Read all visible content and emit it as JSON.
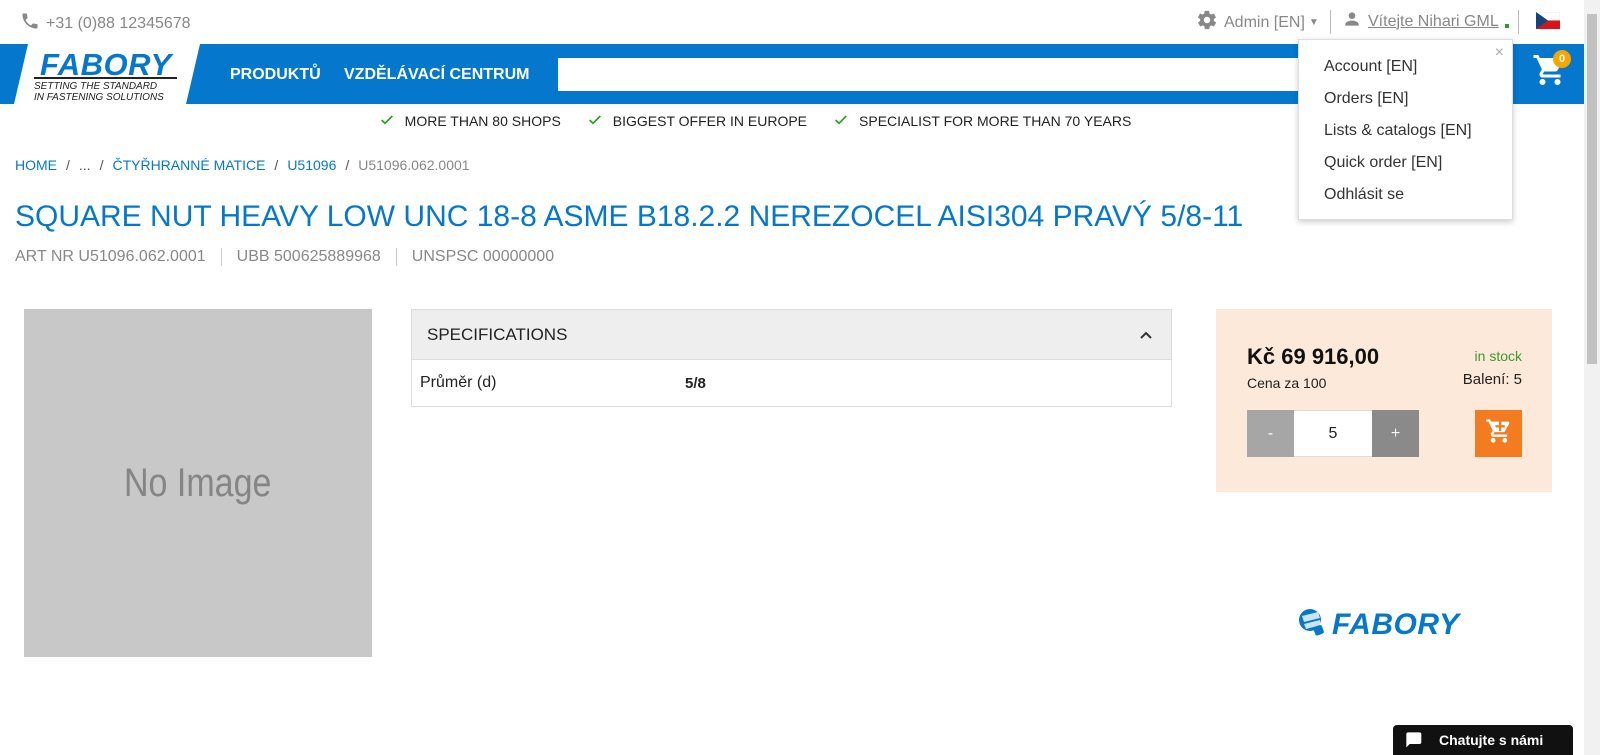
{
  "topbar": {
    "phone": "+31 (0)88 12345678",
    "admin_label": "Admin [EN]",
    "welcome_label": "Vítejte Nihari GML"
  },
  "header": {
    "logo_text": "FABORY",
    "logo_tagline_1": "SETTING THE STANDARD",
    "logo_tagline_2": "IN FASTENING SOLUTIONS",
    "nav": [
      "PRODUKTŮ",
      "VZDĚLÁVACÍ CENTRUM"
    ],
    "search_placeholder": "",
    "cart_count": "0"
  },
  "benefits": [
    "MORE THAN 80 SHOPS",
    "BIGGEST OFFER IN EUROPE",
    "SPECIALIST FOR MORE THAN 70 YEARS"
  ],
  "breadcrumb": {
    "items": [
      "HOME",
      "...",
      "ČTYŘHRANNÉ MATICE",
      "U51096"
    ],
    "current": "U51096.062.0001"
  },
  "product": {
    "title": "SQUARE NUT HEAVY LOW UNC 18-8 ASME B18.2.2 NEREZOCEL AISI304 PRAVÝ 5/8-11",
    "art_nr": "ART NR U51096.062.0001",
    "ubb": "UBB 500625889968",
    "unspsc": "UNSPSC 00000000",
    "image_placeholder": "No Image"
  },
  "specifications": {
    "heading": "SPECIFICATIONS",
    "rows": [
      {
        "key": "Průměr (d)",
        "value": "5/8"
      }
    ]
  },
  "pricing": {
    "price": "Kč 69 916,00",
    "per": "Cena za 100",
    "stock": "in stock",
    "pack": "Balení: 5",
    "minus": "-",
    "plus": "+",
    "quantity": "5"
  },
  "brand_logo": "FABORY",
  "account_menu": {
    "close": "×",
    "items": [
      "Account [EN]",
      "Orders [EN]",
      "Lists & catalogs [EN]",
      "Quick order [EN]",
      "Odhlásit se"
    ]
  },
  "chat": {
    "label": "Chatujte s námi"
  },
  "colors": {
    "brand_blue": "#0578ce",
    "cart_orange": "#f47c20",
    "stock_green": "#3a9a2a",
    "price_box_bg": "#fde9d9"
  }
}
